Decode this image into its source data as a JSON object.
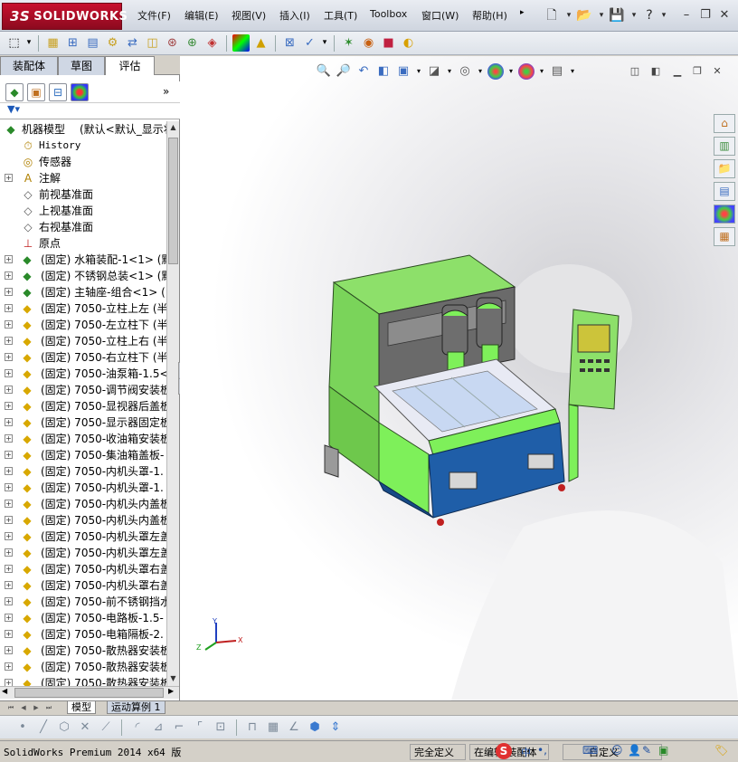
{
  "app": {
    "logo_prefix": "3S",
    "logo_text": "SOLIDWORKS"
  },
  "menus": [
    "文件(F)",
    "编辑(E)",
    "视图(V)",
    "插入(I)",
    "工具(T)",
    "Toolbox",
    "窗口(W)",
    "帮助(H)"
  ],
  "panel_tabs": [
    "装配体",
    "草图",
    "评估"
  ],
  "tree": {
    "root_label": "机器模型",
    "root_config": "(默认<默认_显示状",
    "items": [
      {
        "label": "History",
        "icon": "history-icon",
        "mono": true,
        "expand": false
      },
      {
        "label": "传感器",
        "icon": "sensor-icon",
        "mono": false,
        "expand": false
      },
      {
        "label": "注解",
        "icon": "annotation-icon",
        "mono": false,
        "expand": true
      },
      {
        "label": "前视基准面",
        "icon": "plane-icon",
        "mono": false,
        "expand": false
      },
      {
        "label": "上视基准面",
        "icon": "plane-icon",
        "mono": false,
        "expand": false
      },
      {
        "label": "右视基准面",
        "icon": "plane-icon",
        "mono": false,
        "expand": false
      },
      {
        "label": "原点",
        "icon": "origin-icon",
        "mono": false,
        "expand": false
      }
    ],
    "components": [
      {
        "label": "(固定) 水箱装配-1<1> (默",
        "type": "assembly"
      },
      {
        "label": "(固定) 不锈钢总装<1> (默",
        "type": "assembly"
      },
      {
        "label": "(固定) 主轴座-组合<1> (",
        "type": "assembly"
      },
      {
        "label": "(固定) 7050-立柱上左 (半",
        "type": "part"
      },
      {
        "label": "(固定) 7050-左立柱下 (半",
        "type": "part"
      },
      {
        "label": "(固定) 7050-立柱上右 (半",
        "type": "part"
      },
      {
        "label": "(固定) 7050-右立柱下 (半",
        "type": "part"
      },
      {
        "label": "(固定) 7050-油泵箱-1.5<",
        "type": "part"
      },
      {
        "label": "(固定) 7050-调节阀安装板",
        "type": "part"
      },
      {
        "label": "(固定) 7050-显视器后盖板",
        "type": "part"
      },
      {
        "label": "(固定) 7050-显示器固定板",
        "type": "part"
      },
      {
        "label": "(固定) 7050-收油箱安装板",
        "type": "part"
      },
      {
        "label": "(固定) 7050-集油箱盖板-",
        "type": "part"
      },
      {
        "label": "(固定) 7050-内机头罩-1.",
        "type": "part"
      },
      {
        "label": "(固定) 7050-内机头罩-1.",
        "type": "part"
      },
      {
        "label": "(固定) 7050-内机头内盖板",
        "type": "part"
      },
      {
        "label": "(固定) 7050-内机头内盖板",
        "type": "part"
      },
      {
        "label": "(固定) 7050-内机头罩左盖",
        "type": "part"
      },
      {
        "label": "(固定) 7050-内机头罩左盖",
        "type": "part"
      },
      {
        "label": "(固定) 7050-内机头罩右盖",
        "type": "part"
      },
      {
        "label": "(固定) 7050-内机头罩右盖",
        "type": "part"
      },
      {
        "label": "(固定) 7050-前不锈钢挡水",
        "type": "part"
      },
      {
        "label": "(固定) 7050-电路板-1.5-",
        "type": "part"
      },
      {
        "label": "(固定) 7050-电箱隔板-2.",
        "type": "part"
      },
      {
        "label": "(固定) 7050-散热器安装板",
        "type": "part"
      },
      {
        "label": "(固定) 7050-散热器安装板",
        "type": "part"
      },
      {
        "label": "(固定) 7050-散热器安装板",
        "type": "part"
      }
    ]
  },
  "bottom_tabs": [
    "模型",
    "运动算例 1"
  ],
  "status": {
    "product": "SolidWorks Premium 2014 x64 版",
    "define_state": "完全定义",
    "edit_state": "在编辑",
    "edit_target": "装配体",
    "units": "自定义"
  },
  "triad": {
    "x": "X",
    "y": "Y",
    "z": "Z"
  },
  "colors": {
    "machine_green": "#7ef05a",
    "machine_blue": "#1f5ea8",
    "menu_bar": "#dfe3ea"
  }
}
